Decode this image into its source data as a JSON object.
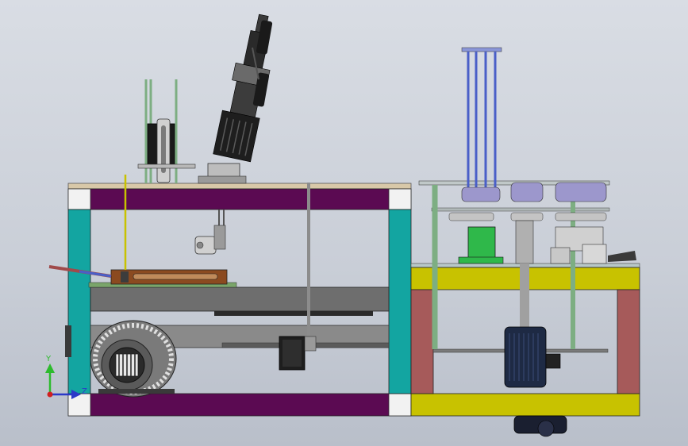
{
  "view": {
    "background_top": "#d9dde4",
    "background_bottom": "#b9bfca"
  },
  "triad": {
    "y_label": "Y",
    "z_label": "Z",
    "y_color": "#2dbb2d",
    "z_color": "#2b39c8",
    "x_color": "#d02020"
  },
  "colors": {
    "frame_purple": "#5b0a52",
    "frame_teal": "#13a5a1",
    "frame_yellow": "#c8c200",
    "frame_red": "#a65a5a",
    "plate_tan": "#d8c8a8",
    "rod_green": "#7dae82",
    "rod_blue": "#4a5fc8",
    "motor_navy": "#1e2a44",
    "slide_brown": "#8b4a20",
    "roll_lavender": "#9c97cc",
    "green_block": "#2fb84a",
    "gray_dark": "#3c3c3c",
    "gray_mid": "#6e6e6e"
  },
  "parts": [
    "left-machine-frame",
    "right-machine-frame",
    "spray-gun-assembly",
    "blower-fan",
    "stepper-motor",
    "linear-slide",
    "roller-stack",
    "drive-motor"
  ]
}
